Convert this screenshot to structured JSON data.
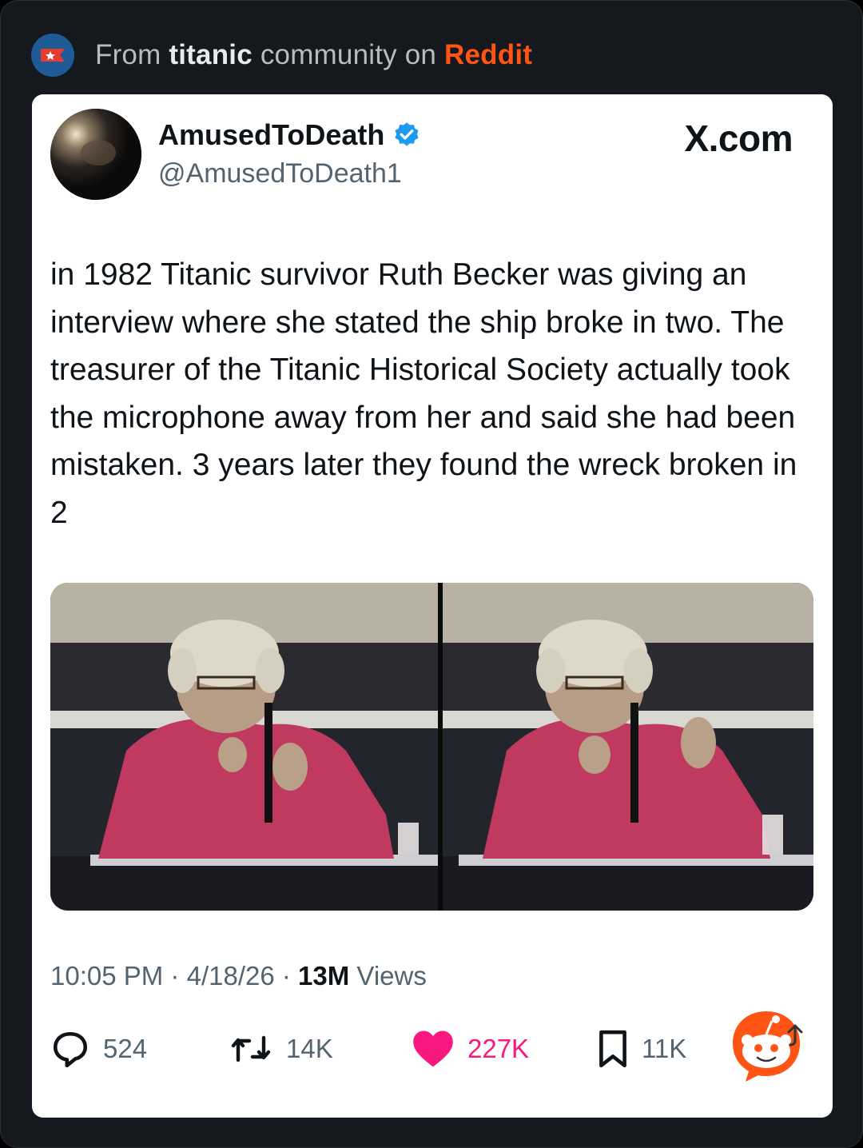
{
  "header": {
    "prefix": "From",
    "community": "titanic",
    "middle": "community on",
    "platform": "Reddit"
  },
  "tweet": {
    "display_name": "AmusedToDeath",
    "handle": "@AmusedToDeath1",
    "source": "X.com",
    "text": "in 1982 Titanic survivor Ruth Becker was giving an interview where she stated the ship broke in two. The treasurer of the Titanic Historical Society actually took the microphone away from her and said she had been mistaken. 3 years later they found the wreck broken in 2",
    "time": "10:05 PM",
    "date": "4/18/26",
    "views_count": "13M",
    "views_label": "Views",
    "sep": "·"
  },
  "actions": {
    "replies": "524",
    "reposts": "14K",
    "likes": "227K",
    "bookmarks": "11K"
  },
  "colors": {
    "reddit_orange": "#ff5414",
    "like_pink": "#f91880",
    "verified_blue": "#1d9bf0"
  },
  "icons": [
    "subreddit-icon",
    "verified-badge-icon",
    "reply-icon",
    "repost-icon",
    "like-heart-icon",
    "bookmark-icon",
    "reddit-snoo-icon"
  ]
}
